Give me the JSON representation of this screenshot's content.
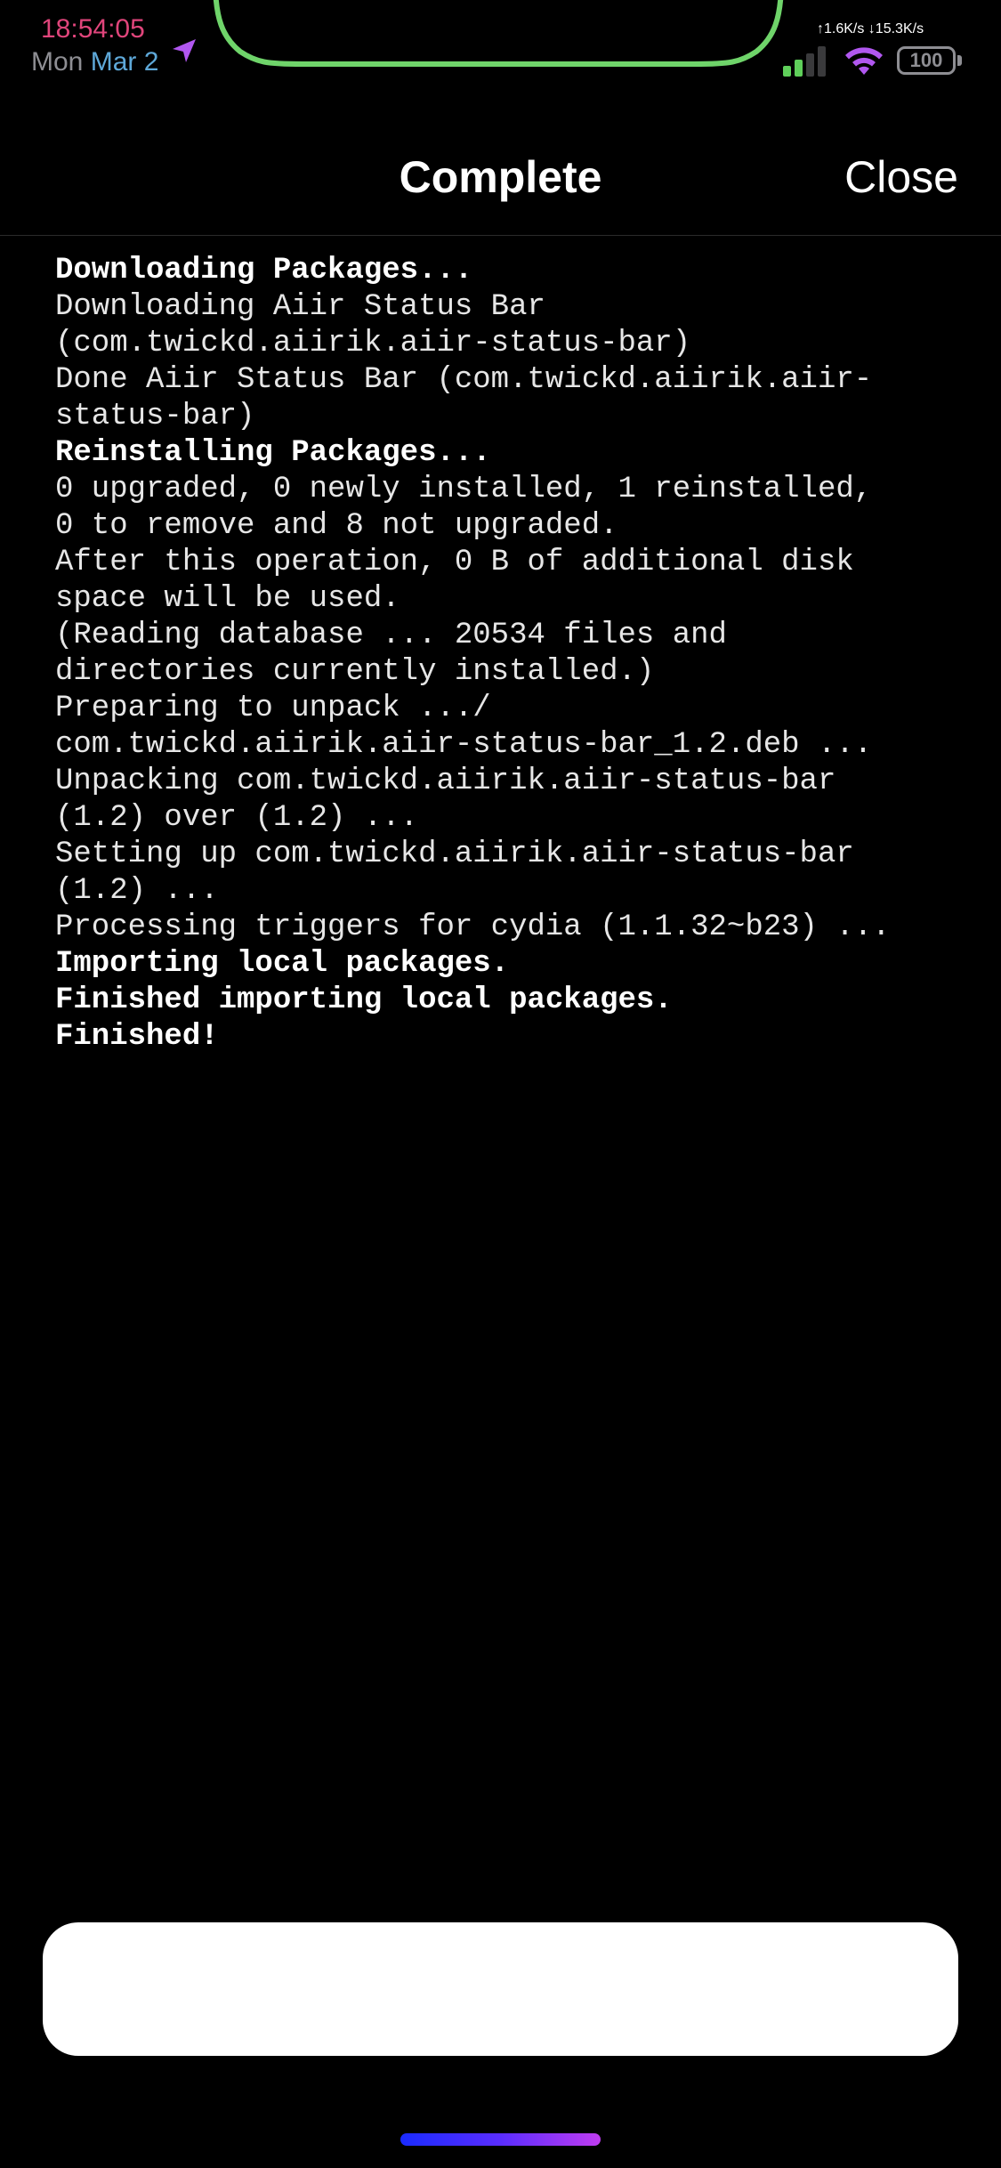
{
  "status_bar": {
    "time": "18:54:05",
    "day": "Mon",
    "month_day": "Mar 2",
    "network_speed": "↑1.6K/s ↓15.3K/s",
    "battery": "100",
    "colors": {
      "time": "#e0457b",
      "notch_outline": "#6fd46a",
      "location_arrow": "#b157f0",
      "wifi": "#b157f0",
      "signal_active": "#5fcf5a"
    }
  },
  "nav": {
    "title": "Complete",
    "close_label": "Close"
  },
  "log": {
    "lines": [
      {
        "text": "Downloading Packages...",
        "bold": true
      },
      {
        "text": "Downloading Aiir Status Bar",
        "bold": false
      },
      {
        "text": "(com.twickd.aiirik.aiir-status-bar)",
        "bold": false
      },
      {
        "text": "Done Aiir Status Bar (com.twickd.aiirik.aiir-",
        "bold": false
      },
      {
        "text": "status-bar)",
        "bold": false
      },
      {
        "text": "Reinstalling Packages...",
        "bold": true
      },
      {
        "text": "0 upgraded, 0 newly installed, 1 reinstalled,",
        "bold": false
      },
      {
        "text": "0 to remove and 8 not upgraded.",
        "bold": false
      },
      {
        "text": "After this operation, 0 B of additional disk",
        "bold": false
      },
      {
        "text": "space will be used.",
        "bold": false
      },
      {
        "text": "(Reading database ... 20534 files and",
        "bold": false
      },
      {
        "text": "directories currently installed.)",
        "bold": false
      },
      {
        "text": "Preparing to unpack .../",
        "bold": false
      },
      {
        "text": "com.twickd.aiirik.aiir-status-bar_1.2.deb ...",
        "bold": false
      },
      {
        "text": "Unpacking com.twickd.aiirik.aiir-status-bar",
        "bold": false
      },
      {
        "text": "(1.2) over (1.2) ...",
        "bold": false
      },
      {
        "text": "Setting up com.twickd.aiirik.aiir-status-bar",
        "bold": false
      },
      {
        "text": "(1.2) ...",
        "bold": false
      },
      {
        "text": "Processing triggers for cydia (1.1.32~b23) ...",
        "bold": false
      },
      {
        "text": "Importing local packages.",
        "bold": true
      },
      {
        "text": "Finished importing local packages.",
        "bold": true
      },
      {
        "text": "Finished!",
        "bold": true
      }
    ]
  },
  "bottom_button": {
    "label": ""
  }
}
